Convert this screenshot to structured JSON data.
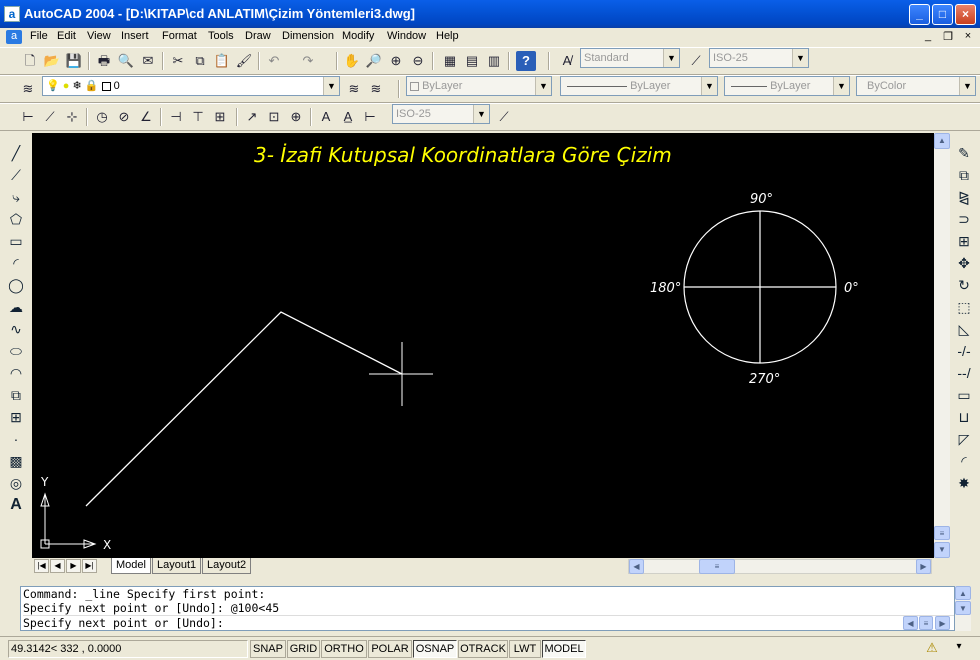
{
  "window": {
    "title": "AutoCAD 2004 - [D:\\KITAP\\cd ANLATIM\\Çizim Yöntemleri3.dwg]",
    "min": "_",
    "max": "□",
    "close": "×"
  },
  "menu": [
    "File",
    "Edit",
    "View",
    "Insert",
    "Format",
    "Tools",
    "Draw",
    "Dimension",
    "Modify",
    "Window",
    "Help"
  ],
  "toolbar": {
    "text_style": "Standard",
    "dim_style": "ISO-25",
    "layer": "0",
    "color": "ByLayer",
    "linetype": "ByLayer",
    "lineweight": "ByLayer",
    "plot_style": "ByColor",
    "dim_style_2": "ISO-25"
  },
  "drawing": {
    "heading": "3- İzafi Kutupsal Koordinatlara Göre Çizim",
    "angle_90": "90°",
    "angle_180": "180°",
    "angle_0": "0°",
    "angle_270": "270°",
    "ucs_x": "X",
    "ucs_y": "Y"
  },
  "tabs": [
    "Model",
    "Layout1",
    "Layout2"
  ],
  "command": {
    "line1": "Command: _line Specify first point:",
    "line2": "Specify next point or [Undo]: @100<45",
    "line3": "Specify next point or [Undo]:"
  },
  "status": {
    "coords": "49.3142<  332   , 0.0000",
    "buttons": [
      "SNAP",
      "GRID",
      "ORTHO",
      "POLAR",
      "OSNAP",
      "OTRACK",
      "LWT",
      "MODEL"
    ],
    "active": [
      "OSNAP",
      "MODEL"
    ]
  },
  "colors": {
    "canvas": "#000000",
    "heading": "#ffff00",
    "lines": "#ffffff",
    "titlebar": "#0054e3"
  }
}
